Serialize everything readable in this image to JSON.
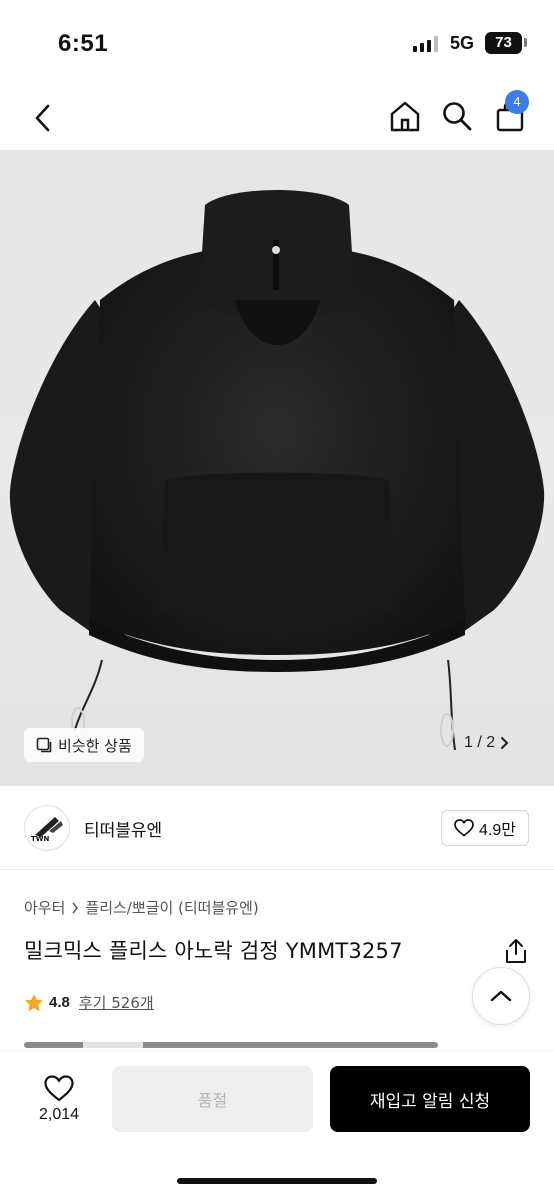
{
  "status_bar": {
    "time": "6:51",
    "network": "5G",
    "battery": "73"
  },
  "nav": {
    "cart_count": "4",
    "icons": [
      "chevron-left-icon",
      "home-icon",
      "search-icon",
      "bag-icon"
    ]
  },
  "image": {
    "similar_label": "비슷한 상품",
    "pager": "1 / 2",
    "pager_icon": "chevron-right-icon"
  },
  "brand": {
    "name": "티떠블유엔",
    "logo_text": "TWN",
    "likes": "4.9만"
  },
  "product": {
    "breadcrumb": [
      "아우터",
      "플리스/뽀글이 (티떠블유엔)"
    ],
    "title": "밀크믹스 플리스 아노락 검정 YMMT3257",
    "rating": "4.8",
    "review_label": "후기 526개",
    "rating_color": "#f5a623"
  },
  "gallery_progress": {
    "index": 1,
    "total": 2
  },
  "bottom_bar": {
    "wish_count": "2,014",
    "soldout_label": "품절",
    "restock_label": "재입고 알림 신청"
  },
  "colors": {
    "badge": "#3d7ee6",
    "primary_button": "#000000"
  }
}
